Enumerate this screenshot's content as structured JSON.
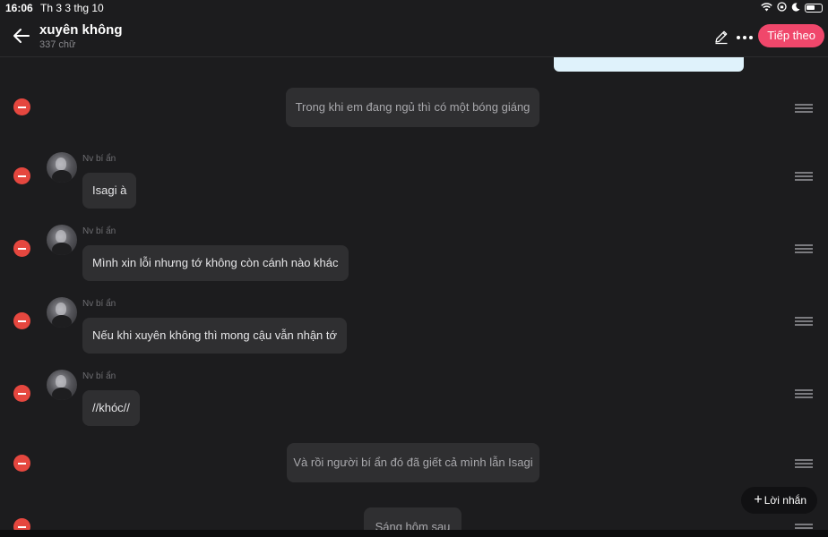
{
  "status": {
    "time": "16:06",
    "date": "Th 3 3 thg 10"
  },
  "header": {
    "title": "xuyên không",
    "word_count": "337 chữ",
    "next_label": "Tiếp theo"
  },
  "messages": [
    {
      "type": "narration",
      "text": "Trong khi em đang ngủ thì có một bóng giáng"
    },
    {
      "type": "character",
      "name": "Nv bí ẩn",
      "text": "Isagi à"
    },
    {
      "type": "character",
      "name": "Nv bí ẩn",
      "text": "Mình xin lỗi nhưng tớ không còn cánh nào khác"
    },
    {
      "type": "character",
      "name": "Nv bí ẩn",
      "text": "Nếu khi xuyên không thì mong cậu vẫn nhận tớ"
    },
    {
      "type": "character",
      "name": "Nv bí ẩn",
      "text": "//khóc//"
    },
    {
      "type": "narration",
      "text": "Và rồi người bí ẩn đó đã giết cả mình lẫn Isagi"
    },
    {
      "type": "narration",
      "text": "Sáng hôm sau"
    }
  ],
  "fab": {
    "label": "Lời nhắn"
  },
  "colors": {
    "accent": "#f0476b",
    "delete": "#e5473f",
    "background": "#1c1c1e",
    "bubble": "#2f2f31"
  }
}
